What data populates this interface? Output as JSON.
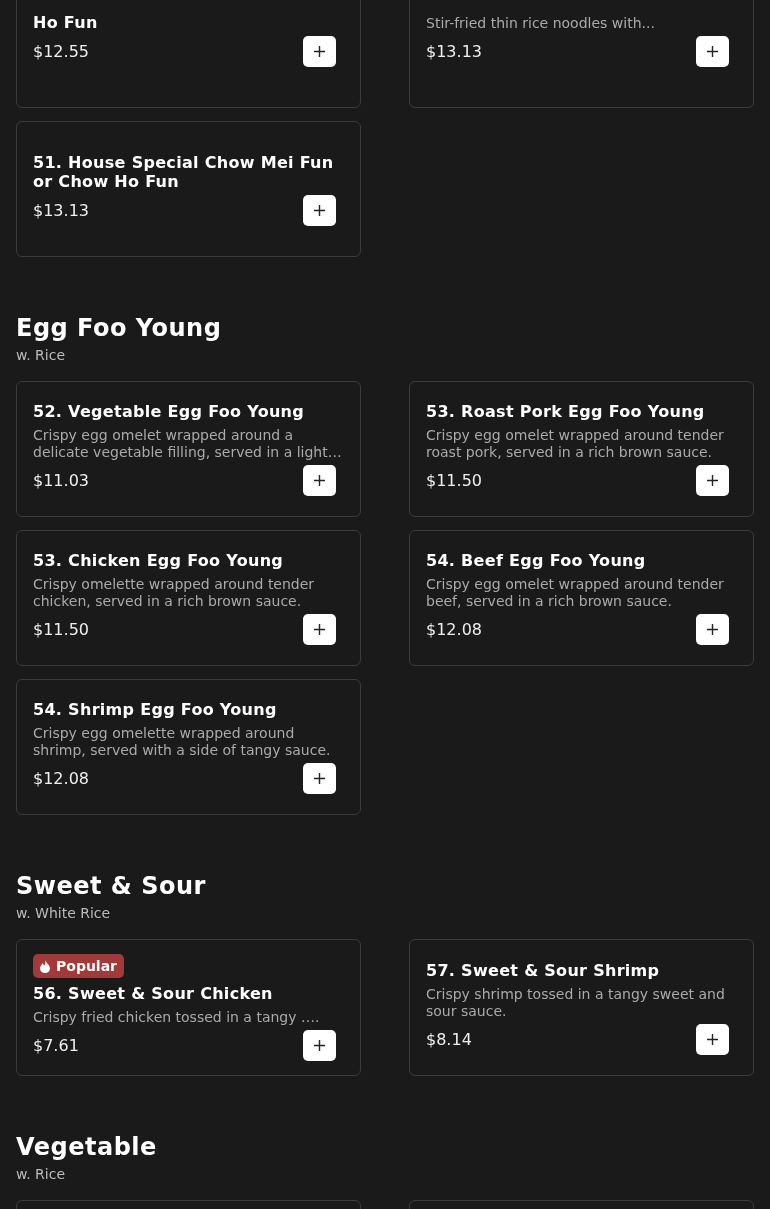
{
  "sections": [
    {
      "items": [
        {
          "kind": "item",
          "title": "Ho Fun",
          "price": "$12.55"
        },
        {
          "kind": "item",
          "description": "Stir-fried thin rice noodles with...",
          "price": "$13.13"
        },
        {
          "kind": "item",
          "title": "51. House Special Chow Mei Fun or Chow Ho Fun",
          "price": "$13.13"
        }
      ]
    },
    {
      "title": "Egg Foo Young",
      "subtitle": "w. Rice",
      "items": [
        {
          "kind": "item",
          "title": "52. Vegetable Egg Foo Young",
          "description": "Crispy egg omelet wrapped around a delicate vegetable filling, served in a light…",
          "price": "$11.03"
        },
        {
          "kind": "item",
          "title": "53. Roast Pork Egg Foo Young",
          "description": "Crispy egg omelet wrapped around tender roast pork, served in a rich brown sauce.",
          "price": "$11.50"
        },
        {
          "kind": "item",
          "title": "53. Chicken Egg Foo Young",
          "description": "Crispy omelette wrapped around tender chicken, served in a rich brown sauce.",
          "price": "$11.50"
        },
        {
          "kind": "item",
          "title": "54. Beef Egg Foo Young",
          "description": "Crispy egg omelet wrapped around tender beef, served in a rich brown sauce.",
          "price": "$12.08"
        },
        {
          "kind": "item",
          "title": "54. Shrimp Egg Foo Young",
          "description": "Crispy egg omelette wrapped around shrimp, served with a side of tangy sauce.",
          "price": "$12.08"
        }
      ]
    },
    {
      "title": "Sweet & Sour",
      "subtitle": "w. White Rice",
      "items": [
        {
          "kind": "item",
          "badge": "Popular",
          "title": "56. Sweet & Sour Chicken",
          "description": "Crispy fried chicken tossed in a tangy ….",
          "price": "$7.61"
        },
        {
          "kind": "item",
          "title": "57. Sweet & Sour Shrimp",
          "description": "Crispy shrimp tossed in a tangy sweet and sour sauce.",
          "price": "$8.14"
        }
      ]
    },
    {
      "title": "Vegetable",
      "subtitle": "w. Rice",
      "items": [
        {
          "kind": "stub"
        },
        {
          "kind": "stub"
        }
      ]
    }
  ]
}
